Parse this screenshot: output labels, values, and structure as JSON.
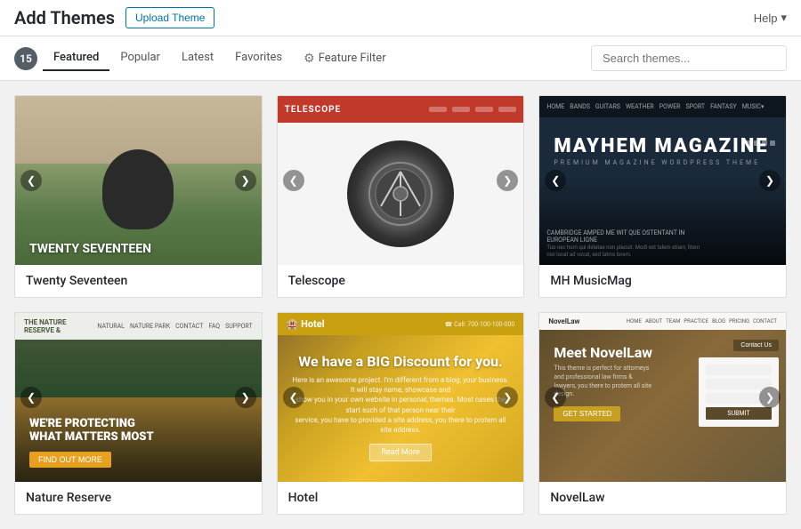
{
  "header": {
    "title": "Add Themes",
    "upload_btn": "Upload Theme",
    "help_btn": "Help"
  },
  "filter_bar": {
    "count": "15",
    "tabs": [
      {
        "id": "featured",
        "label": "Featured",
        "active": true
      },
      {
        "id": "popular",
        "label": "Popular",
        "active": false
      },
      {
        "id": "latest",
        "label": "Latest",
        "active": false
      },
      {
        "id": "favorites",
        "label": "Favorites",
        "active": false
      }
    ],
    "feature_filter_label": "Feature Filter",
    "search_placeholder": "Search themes..."
  },
  "themes": [
    {
      "id": "twenty-seventeen",
      "name": "Twenty Seventeen",
      "preview_type": "twenty-seventeen"
    },
    {
      "id": "telescope",
      "name": "Telescope",
      "preview_type": "telescope"
    },
    {
      "id": "mh-musicmag",
      "name": "MH MusicMag",
      "preview_type": "mh-musicmag"
    },
    {
      "id": "nature-reserve",
      "name": "Nature Reserve",
      "preview_type": "nature-reserve"
    },
    {
      "id": "hotel",
      "name": "Hotel",
      "preview_type": "hotel"
    },
    {
      "id": "novellaw",
      "name": "NovelLaw",
      "preview_type": "novellaw"
    }
  ],
  "icons": {
    "chevron_left": "❮",
    "chevron_right": "❯",
    "chevron_down": "▾",
    "gear": "⚙",
    "search": "🔍"
  }
}
